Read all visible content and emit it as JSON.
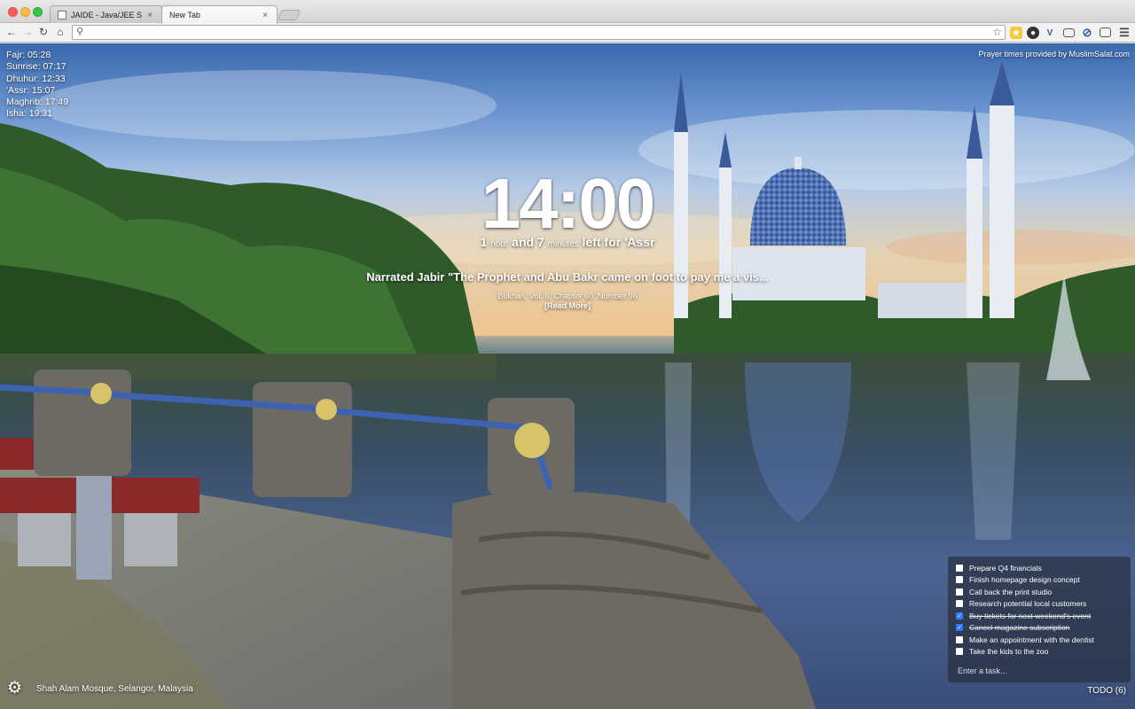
{
  "browser": {
    "tabs": [
      {
        "title": "JAIDE - Java/JEE Software",
        "close": "×",
        "active": false
      },
      {
        "title": "New Tab",
        "close": "×",
        "active": true
      }
    ],
    "address": {
      "value": "",
      "placeholder": ""
    },
    "colors": {
      "accent": "#2b7cff"
    }
  },
  "prayer_times": {
    "items": [
      {
        "name": "Fajr",
        "time": "05:28"
      },
      {
        "name": "Sunrise",
        "time": "07:17"
      },
      {
        "name": "Dhuhur",
        "time": "12:33"
      },
      {
        "name": "'Assr",
        "time": "15:07"
      },
      {
        "name": "Maghrib",
        "time": "17:49"
      },
      {
        "name": "Isha",
        "time": "19:31"
      }
    ],
    "provider_text": "Prayer times provided by MuslimSalat.com"
  },
  "clock": {
    "time": "14:00",
    "countdown": {
      "hours": "1",
      "hours_unit": "hour",
      "and": "and",
      "minutes": "7",
      "minutes_unit": "minutes",
      "suffix": "left for 'Assr"
    }
  },
  "hadith": {
    "text": "Narrated Jabir \"The Prophet and Abu Bakr came on foot to pay me a vis...",
    "source": "Bukhari, Vol. 6, Chapter 60, Number 96",
    "read_more": "[Read More]"
  },
  "location": "Shah Alam Mosque, Selangor, Malaysia",
  "todo": {
    "items": [
      {
        "label": "Prepare Q4 financials",
        "done": false
      },
      {
        "label": "Finish homepage design concept",
        "done": false
      },
      {
        "label": "Call back the print studio",
        "done": false
      },
      {
        "label": "Research potential local customers",
        "done": false
      },
      {
        "label": "Buy tickets for next weekend's event",
        "done": true
      },
      {
        "label": "Cancel magazine subscription",
        "done": true
      },
      {
        "label": "Make an appointment with the dentist",
        "done": false
      },
      {
        "label": "Take the kids to the zoo",
        "done": false
      }
    ],
    "input_placeholder": "Enter a task...",
    "toggle_label": "TODO (6)"
  },
  "icons": {
    "settings": "gear-icon",
    "search": "search-icon",
    "star": "bookmark-star-icon"
  }
}
